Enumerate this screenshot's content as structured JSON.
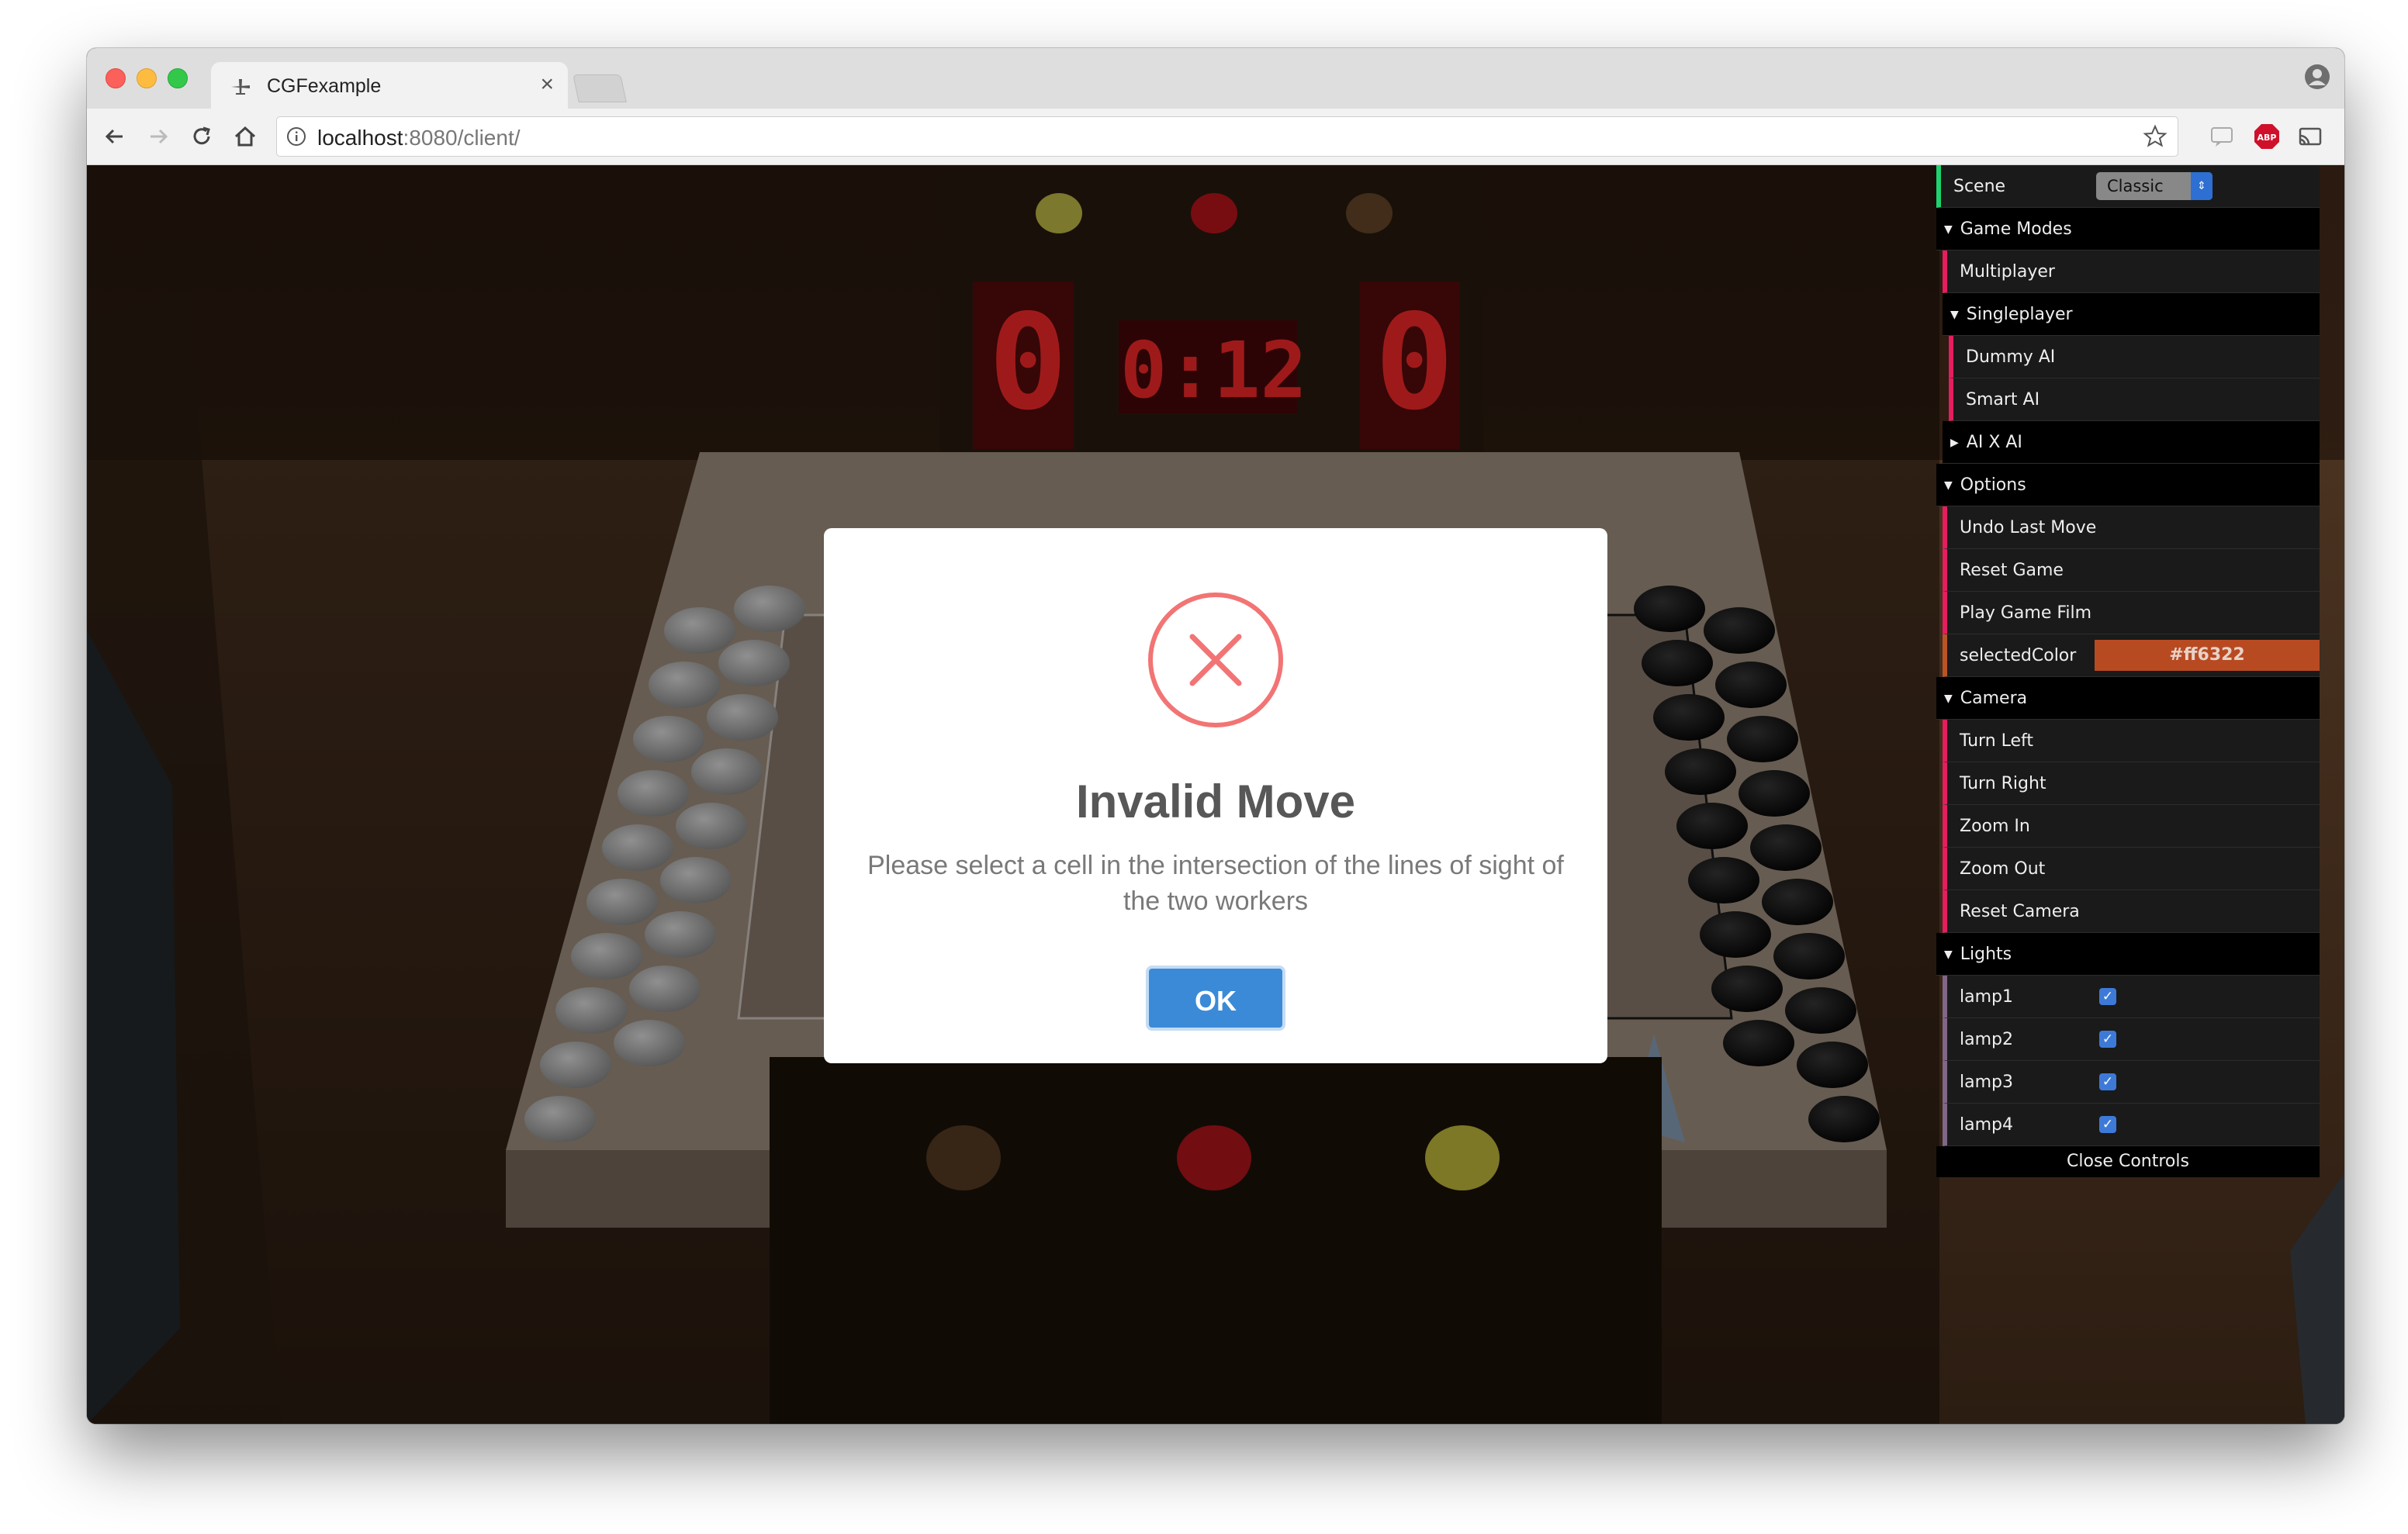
{
  "browser": {
    "tab_title": "CGFexample",
    "tab_close": "×",
    "url_host": "localhost",
    "url_path": ":8080/client/"
  },
  "scene": {
    "scoreboard_left": "0",
    "timer": "0:12",
    "scoreboard_right": "0"
  },
  "dialog": {
    "icon": "error-x-icon",
    "title": "Invalid Move",
    "message": "Please select a cell in the intersection of the lines of sight of the two workers",
    "ok_label": "OK"
  },
  "controls": {
    "scene_label": "Scene",
    "scene_value": "Classic",
    "game_modes": {
      "label": "Game Modes",
      "multiplayer": "Multiplayer",
      "singleplayer": {
        "label": "Singleplayer",
        "dummy_ai": "Dummy AI",
        "smart_ai": "Smart AI"
      },
      "ai_x_ai": "AI X AI"
    },
    "options": {
      "label": "Options",
      "undo": "Undo Last Move",
      "reset_game": "Reset Game",
      "play_film": "Play Game Film",
      "selected_color_label": "selectedColor",
      "selected_color_value": "#ff6322"
    },
    "camera": {
      "label": "Camera",
      "turn_left": "Turn Left",
      "turn_right": "Turn Right",
      "zoom_in": "Zoom In",
      "zoom_out": "Zoom Out",
      "reset_camera": "Reset Camera"
    },
    "lights": {
      "label": "Lights",
      "lamp1": "lamp1",
      "lamp2": "lamp2",
      "lamp3": "lamp3",
      "lamp4": "lamp4",
      "lamp1_on": true,
      "lamp2_on": true,
      "lamp3_on": true,
      "lamp4_on": true
    },
    "close_controls": "Close Controls"
  },
  "colors": {
    "accent_blue": "#3b8ad8",
    "error_red": "#f27474",
    "function_border": "#e61d5f",
    "color_swatch": "#b84a22"
  }
}
